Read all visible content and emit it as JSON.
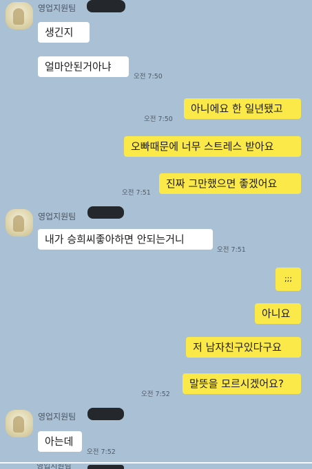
{
  "sender_name": "영업지원팀",
  "messages": [
    {
      "side": "in",
      "text": "생긴지"
    },
    {
      "side": "in",
      "text": "얼마안된거아냐",
      "time": "오전 7:50"
    },
    {
      "side": "out",
      "text": "아니에요 한 일년됐고",
      "time": "오전 7:50"
    },
    {
      "side": "out",
      "text": "오빠때문에 너무 스트레스 받아요"
    },
    {
      "side": "out",
      "text": "진짜 그만했으면 좋겠어요",
      "time": "오전 7:51"
    },
    {
      "side": "in",
      "text": "내가 승희씨좋아하면 안되는거니",
      "time": "오전 7:51"
    },
    {
      "side": "out",
      "text": ";;;"
    },
    {
      "side": "out",
      "text": "아니요"
    },
    {
      "side": "out",
      "text": "저 남자친구있다구요"
    },
    {
      "side": "out",
      "text": "말뜻을 모르시겠어요?",
      "time": "오전 7:52"
    },
    {
      "side": "in",
      "text": "아는데",
      "time": "오전 7:52"
    }
  ],
  "colors": {
    "background": "#a9c0d5",
    "outgoing": "#fbe94a",
    "incoming": "#ffffff",
    "redaction": "#24272b"
  },
  "icons": [
    "avatar-icon"
  ]
}
